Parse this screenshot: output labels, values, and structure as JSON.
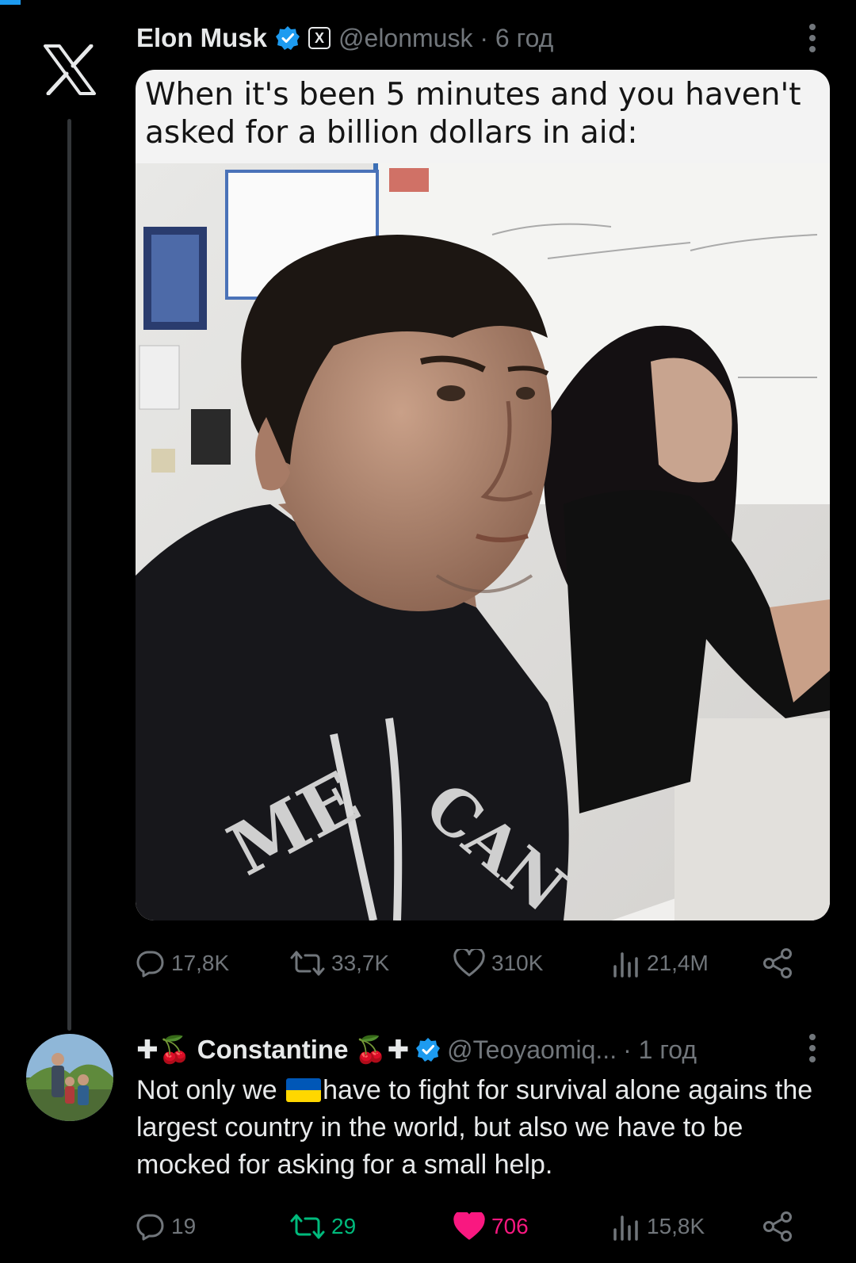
{
  "tweet": {
    "author_name": "Elon Musk",
    "x_badge": "X",
    "handle_time": "@elonmusk · 6 год",
    "meme_caption": "When it's been 5 minutes and you haven't asked for a billion dollars in aid:",
    "stats": {
      "replies": "17,8K",
      "reposts": "33,7K",
      "likes": "310K",
      "views": "21,4M"
    }
  },
  "reply": {
    "name_prefix": "✚🍒",
    "author_name": "Constantine",
    "name_suffix": "🍒✚",
    "handle": "@Teoyaomiq...",
    "time": "· 1 год",
    "text_before_flag": "Not only we",
    "text_after_flag": "have to fight for survival alone agains the largest country in the world, but also we have to be mocked for asking for a small help.",
    "stats": {
      "replies": "19",
      "reposts": "29",
      "likes": "706",
      "views": "15,8K"
    }
  },
  "colors": {
    "accent": "#1d9bf0",
    "muted": "#71767b",
    "repost_active": "#00ba7c",
    "like_active": "#f91880"
  },
  "icons": [
    "x-logo-icon",
    "verified-icon",
    "more-icon",
    "reply-icon",
    "repost-icon",
    "like-icon",
    "views-icon",
    "share-icon"
  ]
}
